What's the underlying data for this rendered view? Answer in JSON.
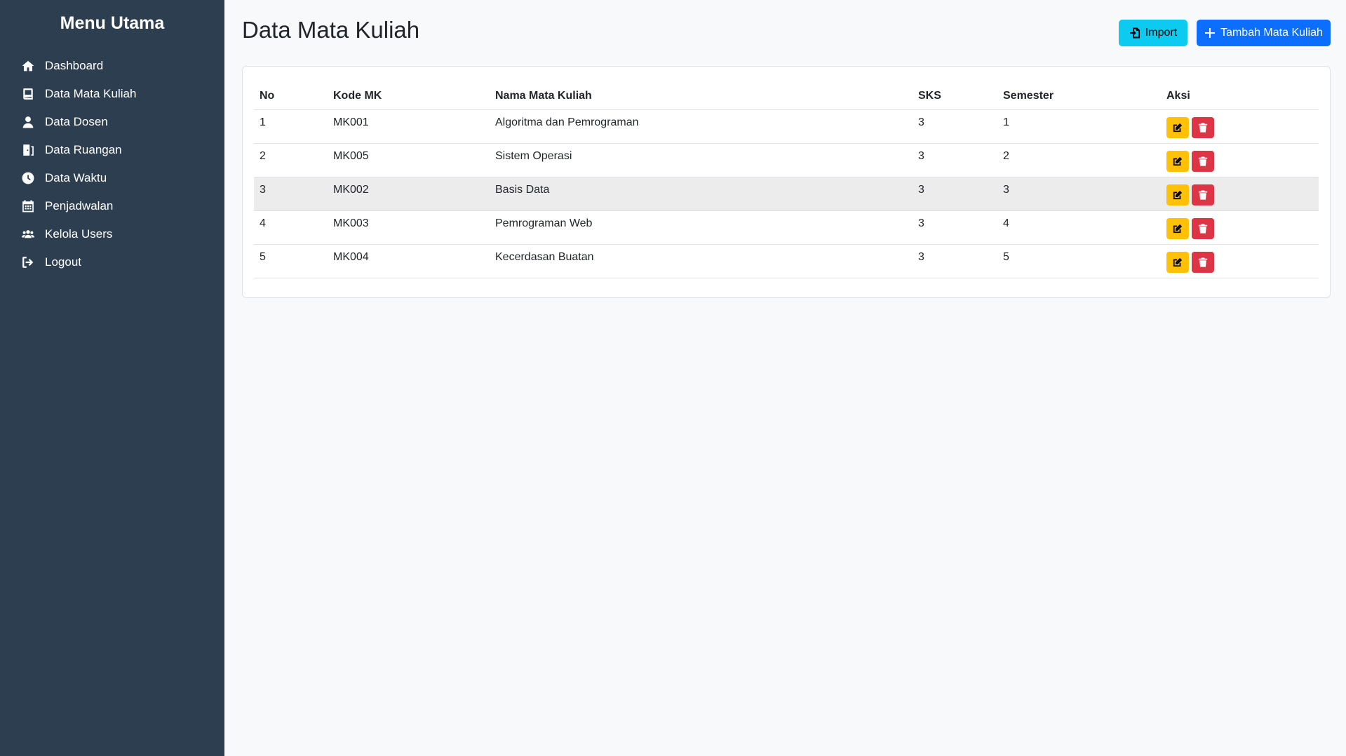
{
  "sidebar": {
    "title": "Menu Utama",
    "items": [
      {
        "label": "Dashboard",
        "icon": "home-icon"
      },
      {
        "label": "Data Mata Kuliah",
        "icon": "book-icon"
      },
      {
        "label": "Data Dosen",
        "icon": "user-icon"
      },
      {
        "label": "Data Ruangan",
        "icon": "door-icon"
      },
      {
        "label": "Data Waktu",
        "icon": "clock-icon"
      },
      {
        "label": "Penjadwalan",
        "icon": "calendar-icon"
      },
      {
        "label": "Kelola Users",
        "icon": "users-icon"
      },
      {
        "label": "Logout",
        "icon": "logout-icon"
      }
    ]
  },
  "header": {
    "title": "Data Mata Kuliah",
    "import_label": "Import",
    "add_label": "Tambah Mata Kuliah"
  },
  "table": {
    "columns": [
      "No",
      "Kode MK",
      "Nama Mata Kuliah",
      "SKS",
      "Semester",
      "Aksi"
    ],
    "rows": [
      {
        "no": "1",
        "kode": "MK001",
        "nama": "Algoritma dan Pemrograman",
        "sks": "3",
        "semester": "1"
      },
      {
        "no": "2",
        "kode": "MK005",
        "nama": "Sistem Operasi",
        "sks": "3",
        "semester": "2"
      },
      {
        "no": "3",
        "kode": "MK002",
        "nama": "Basis Data",
        "sks": "3",
        "semester": "3"
      },
      {
        "no": "4",
        "kode": "MK003",
        "nama": "Pemrograman Web",
        "sks": "3",
        "semester": "4"
      },
      {
        "no": "5",
        "kode": "MK004",
        "nama": "Kecerdasan Buatan",
        "sks": "3",
        "semester": "5"
      }
    ]
  },
  "colors": {
    "sidebar_bg": "#2c3e50",
    "import_button": "#0dcaf0",
    "add_button": "#0d6efd",
    "edit_button": "#ffc107",
    "delete_button": "#dc3545"
  }
}
